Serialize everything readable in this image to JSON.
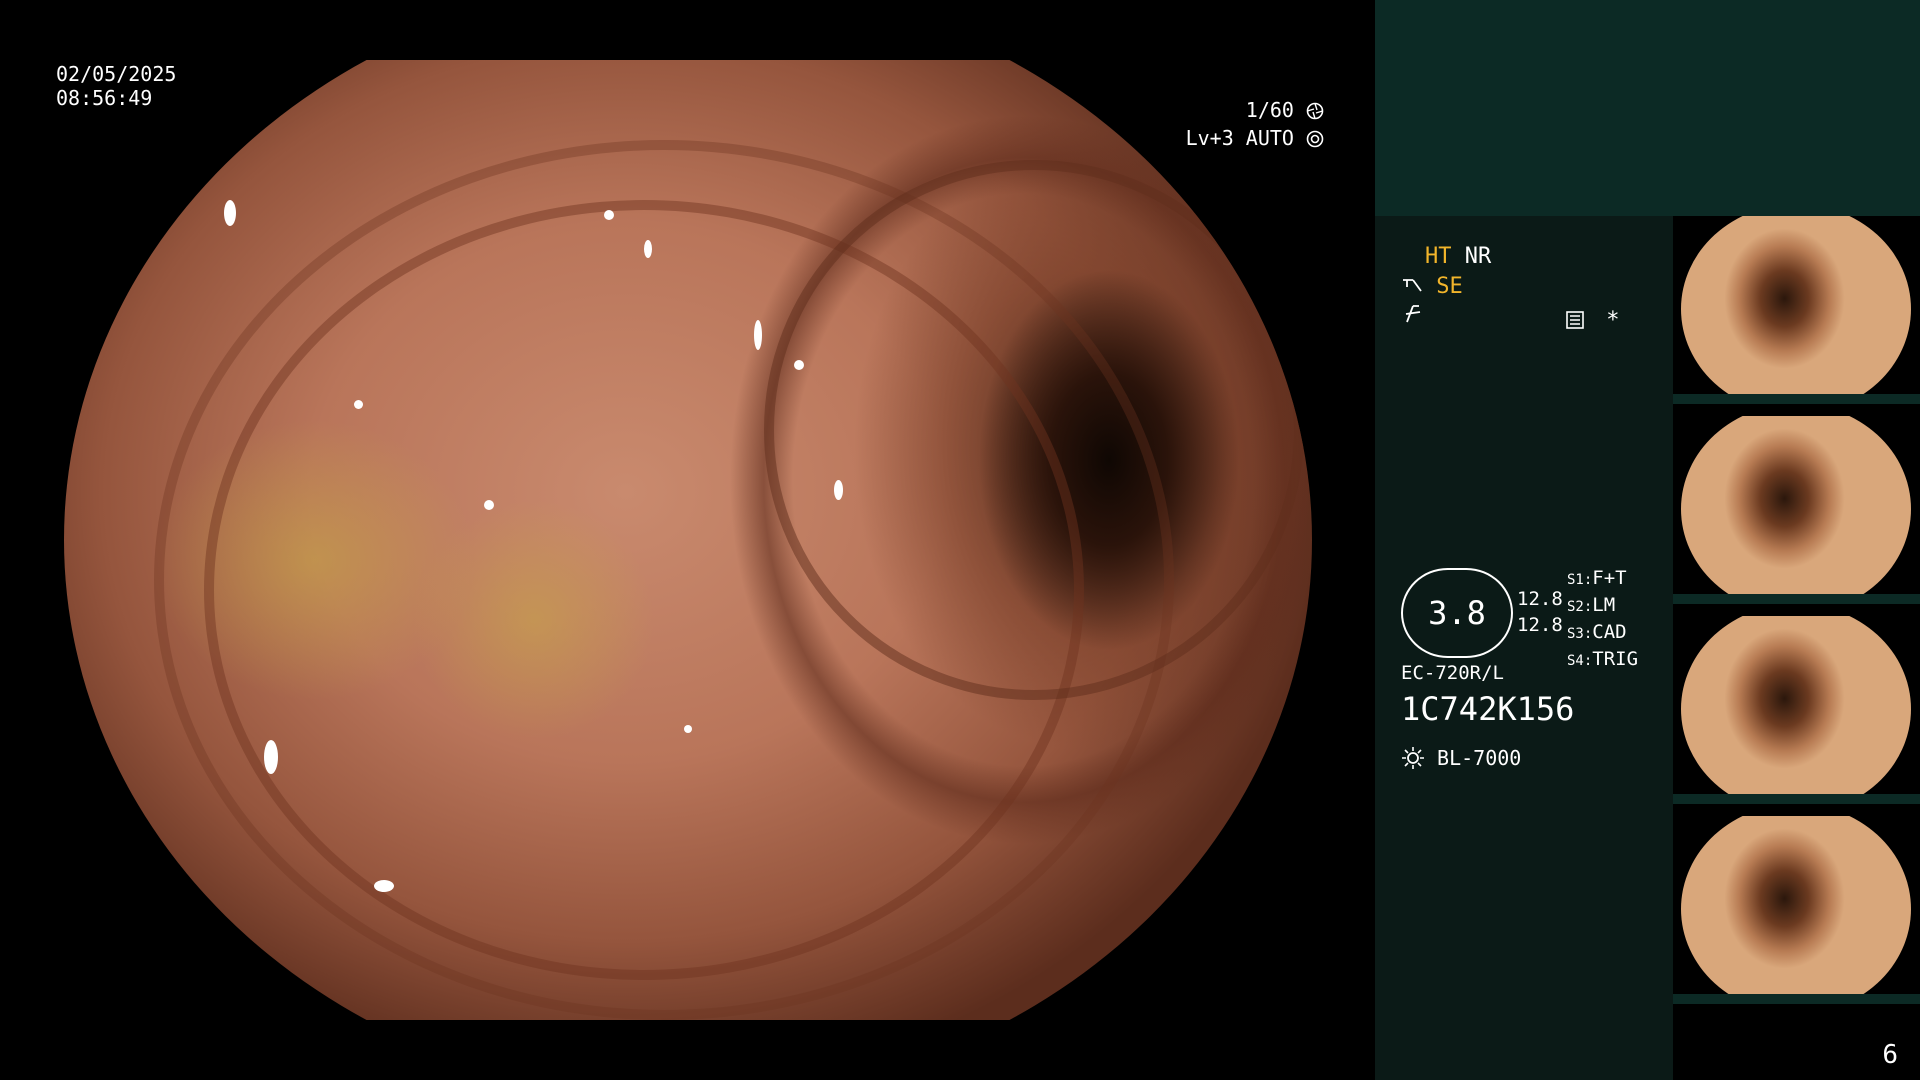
{
  "endoscope": {
    "date": "02/05/2025",
    "time": "08:56:49",
    "shutter": "1/60",
    "level": "Lv+3 AUTO"
  },
  "sidebar": {
    "ht": "HT",
    "nr": "NR",
    "se": "SE",
    "star": "*",
    "magnification": "3.8",
    "value_1": "12.8",
    "value_2": "12.8",
    "switches": [
      {
        "key": "S1:",
        "value": "F+T"
      },
      {
        "key": "S2:",
        "value": "LM"
      },
      {
        "key": "S3:",
        "value": "CAD"
      },
      {
        "key": "S4:",
        "value": "TRIG"
      }
    ],
    "scope_model": "EC-720R/L",
    "serial": "1C742K156",
    "light_source": "BL-7000"
  },
  "page_number": "6",
  "colors": {
    "panel_top": "#0c2a25",
    "panel_info": "#0b1a17",
    "highlight": "#f2b52b"
  },
  "icons": [
    "aperture-icon",
    "iris-icon",
    "scope-icon",
    "enhance-icon",
    "film-icon",
    "sun-icon"
  ]
}
